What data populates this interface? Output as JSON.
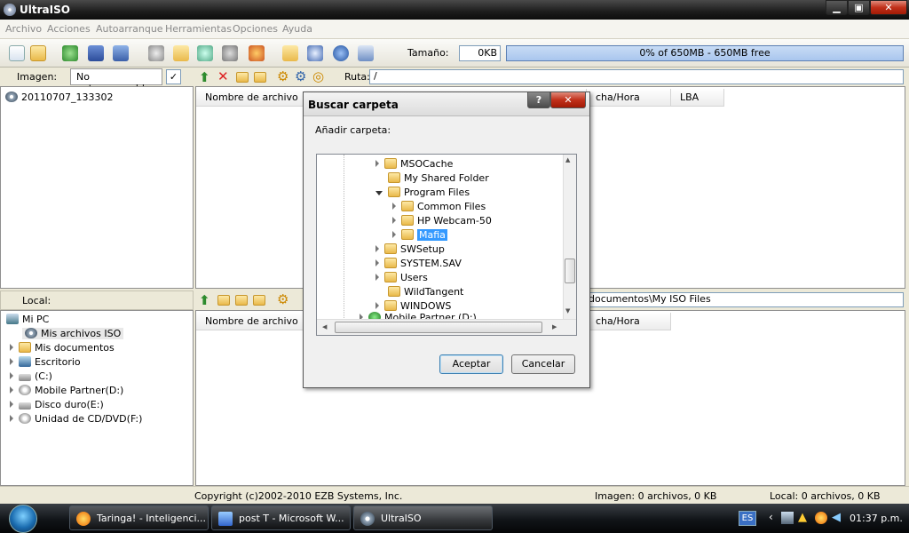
{
  "window": {
    "title": "UltraISO",
    "min": "▁",
    "max": "▣",
    "close": "✕"
  },
  "menu": [
    "Archivo",
    "Acciones",
    "Autoarranque",
    "Herramientas",
    "Opciones",
    "Ayuda"
  ],
  "toolbar": {
    "size_label": "Tamaño:",
    "size_value": "0KB",
    "capacity": "0% of 650MB - 650MB free"
  },
  "image_panel": {
    "label": "Imagen:",
    "boot_status": "No autoarrancable",
    "root_item": "20110707_133302"
  },
  "iso_panel": {
    "path_label": "Ruta:",
    "path": "/",
    "col_name": "Nombre de archivo",
    "col_datetime": "cha/Hora",
    "col_lba": "LBA"
  },
  "local_panel": {
    "label": "Local:",
    "tree": [
      "Mi PC",
      "Mis archivos ISO",
      "Mis documentos",
      "Escritorio",
      "(C:)",
      "Mobile Partner(D:)",
      "Disco duro(E:)",
      "Unidad de CD/DVD(F:)"
    ],
    "path": "documentos\\My ISO Files",
    "col_name": "Nombre de archivo",
    "col_datetime": "cha/Hora"
  },
  "dialog": {
    "title": "Buscar carpeta",
    "help": "?",
    "close": "✕",
    "prompt": "Añadir carpeta:",
    "folders": [
      "MSOCache",
      "My Shared Folder",
      "Program Files",
      "Common Files",
      "HP Webcam-50",
      "Mafia",
      "SWSetup",
      "SYSTEM.SAV",
      "Users",
      "WildTangent",
      "WINDOWS",
      "Mobile Partner (D:)"
    ],
    "selected": "Mafia",
    "ok": "Aceptar",
    "cancel": "Cancelar"
  },
  "status": {
    "copyright": "Copyright (c)2002-2010 EZB Systems, Inc.",
    "image_count": "Imagen: 0 archivos, 0 KB",
    "local_count": "Local: 0 archivos, 0 KB"
  },
  "taskbar": {
    "items": [
      "Taringa! - Inteligenci...",
      "post T - Microsoft W...",
      "UltraISO"
    ],
    "lang": "ES",
    "clock": "01:37 p.m."
  },
  "icons": [
    "new-icon",
    "open-icon",
    "save-icon",
    "folder-icon",
    "help-icon",
    "exit-icon"
  ]
}
